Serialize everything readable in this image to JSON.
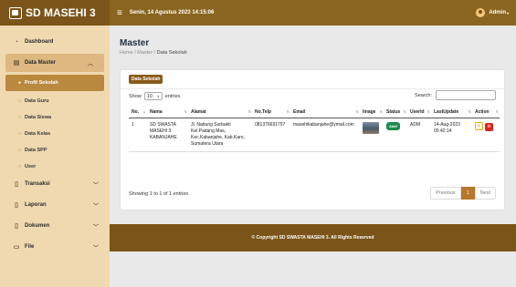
{
  "brand": {
    "title": "SD MASEHI 3"
  },
  "topbar": {
    "datetime": "Senin, 14 Agustus 2023 14:15:06",
    "user": "Admin"
  },
  "sidebar": {
    "items": [
      {
        "label": "Dashboard",
        "icon": "dashboard-icon"
      },
      {
        "label": "Data Master",
        "icon": "folder-icon"
      },
      {
        "label": "Transaksi",
        "icon": "transaction-icon"
      },
      {
        "label": "Laporan",
        "icon": "report-icon"
      },
      {
        "label": "Dokumen",
        "icon": "document-icon"
      },
      {
        "label": "File",
        "icon": "file-icon"
      }
    ],
    "subitems": [
      "Profil Sekolah",
      "Data Guru",
      "Data Siswa",
      "Data Kelas",
      "Data SPP",
      "User"
    ]
  },
  "page": {
    "title": "Master",
    "breadcrumb": {
      "home": "Home",
      "sep": " / ",
      "master": "Master",
      "current": "Data Sekolah"
    }
  },
  "card": {
    "tag": "Data Sekolah",
    "show_label": "Show",
    "show_value": "10",
    "entries_label": "entries",
    "search_label": "Search:",
    "search_value": ""
  },
  "table": {
    "headers": [
      "No.",
      "Nama",
      "Alamat",
      "No.Telp",
      "Email",
      "Image",
      "Status",
      "UserId",
      "LastUpdate",
      "Action"
    ],
    "rows": [
      {
        "no": "1",
        "nama": "SD SWASTA MASEHI 3 KABANJAHE",
        "alamat": "Jl. Nabung Surbakti Kel.Padang Mas, Kec.Kabanjahe, Kab.Karo, Sumatera Utara",
        "telp": "081376691797",
        "email": "masehikabanjahe@ymail.com",
        "status": "Aktif",
        "userid": "ADM",
        "lastupdate": "14-Aug-2023 05:42:14"
      }
    ]
  },
  "footer_info": {
    "showing": "Showing 1 to 1 of 1 entries"
  },
  "pager": {
    "prev": "Previous",
    "page": "1",
    "next": "Next"
  },
  "footer": {
    "text": "© Copyright SD SWASTA MASEHI 3. All Rights Reserved"
  },
  "colors": {
    "brand": "#7a5418",
    "accent": "#b8772a",
    "sidebar": "#f0d9b0",
    "status_active": "#1f8a4c"
  }
}
